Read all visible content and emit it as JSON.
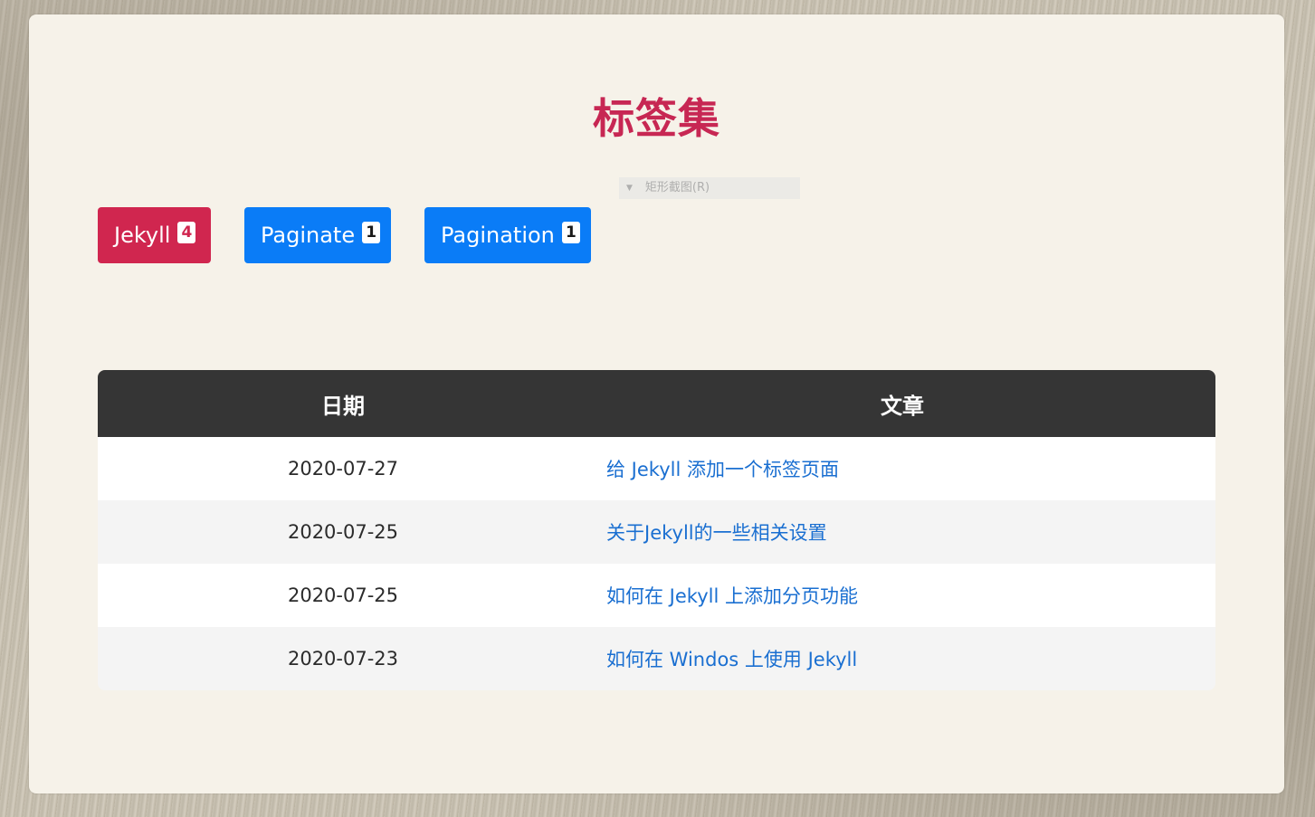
{
  "page": {
    "title": "标签集"
  },
  "overlay": {
    "icon": "caret-down-icon",
    "text": "矩形截图(R)"
  },
  "tags": [
    {
      "label": "Jekyll",
      "count": "4",
      "color": "#d0264f",
      "active": true
    },
    {
      "label": "Paginate",
      "count": "1",
      "color": "#0a7cf7",
      "active": false
    },
    {
      "label": "Pagination",
      "count": "1",
      "color": "#0a7cf7",
      "active": false
    }
  ],
  "table": {
    "headers": {
      "date": "日期",
      "article": "文章"
    },
    "rows": [
      {
        "date": "2020-07-27",
        "article": "给 Jekyll 添加一个标签页面"
      },
      {
        "date": "2020-07-25",
        "article": "关于Jekyll的一些相关设置"
      },
      {
        "date": "2020-07-25",
        "article": "如何在 Jekyll 上添加分页功能"
      },
      {
        "date": "2020-07-23",
        "article": "如何在 Windos 上使用 Jekyll"
      }
    ]
  },
  "colors": {
    "accent": "#c72753",
    "primary": "#0a7cf7",
    "link": "#1a6fd1",
    "table_header_bg": "#353535",
    "panel_bg": "#f6f2e9"
  }
}
